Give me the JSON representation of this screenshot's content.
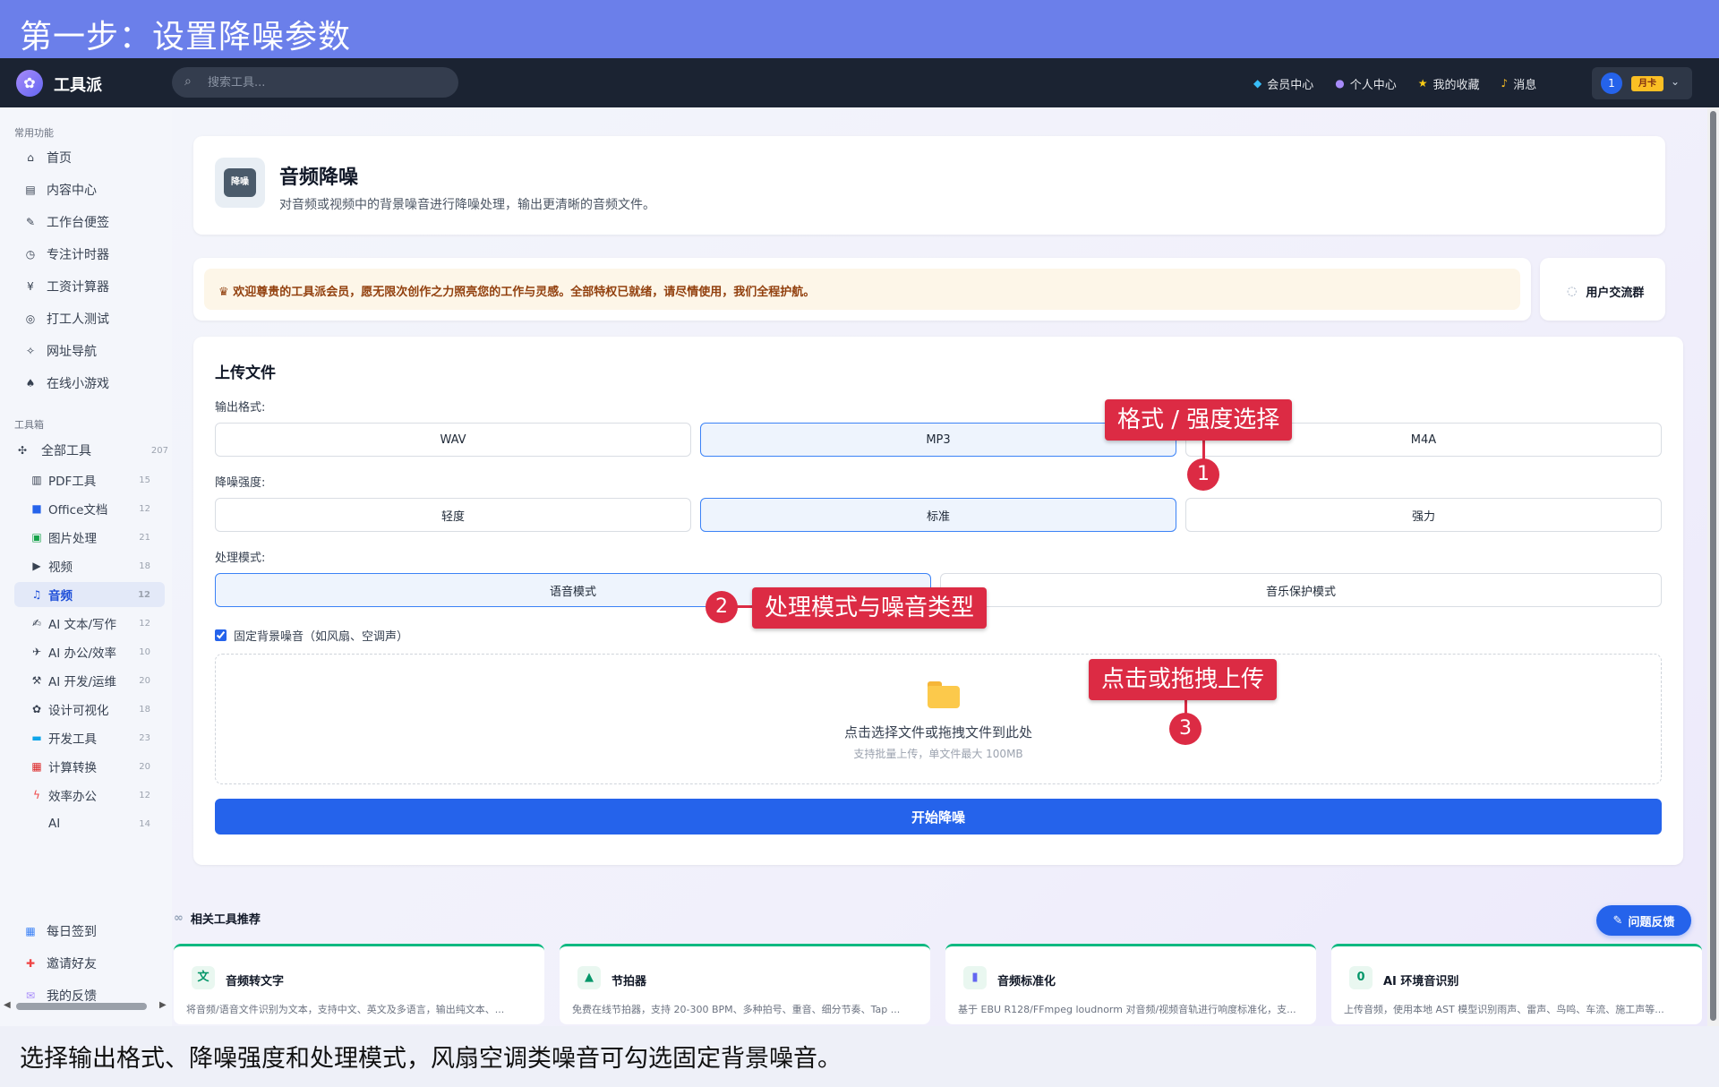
{
  "banner": {
    "title": "第一步：设置降噪参数"
  },
  "caption": {
    "text": "选择输出格式、降噪强度和处理模式，风扇空调类噪音可勾选固定背景噪音。"
  },
  "navbar": {
    "brand": "工具派",
    "search_placeholder": "搜索工具...",
    "links": [
      {
        "icon": "diamond-icon",
        "label": "会员中心"
      },
      {
        "icon": "user-icon",
        "label": "个人中心"
      },
      {
        "icon": "star-icon",
        "label": "我的收藏"
      },
      {
        "icon": "bell-icon",
        "label": "消息"
      }
    ],
    "avatar_text": "1",
    "badge": "月卡"
  },
  "sidebar": {
    "common_title": "常用功能",
    "common": [
      {
        "icon": "home-icon",
        "label": "首页"
      },
      {
        "icon": "content-icon",
        "label": "内容中心"
      },
      {
        "icon": "note-icon",
        "label": "工作台便签"
      },
      {
        "icon": "timer-icon",
        "label": "专注计时器"
      },
      {
        "icon": "salary-icon",
        "label": "工资计算器"
      },
      {
        "icon": "target-icon",
        "label": "打工人测试"
      },
      {
        "icon": "compass-icon",
        "label": "网址导航"
      },
      {
        "icon": "gamepad-icon",
        "label": "在线小游戏"
      }
    ],
    "toolbox_title": "工具箱",
    "all_tools": {
      "label": "全部工具",
      "count": "207"
    },
    "categories": [
      {
        "icon": "pdf-icon",
        "label": "PDF工具",
        "count": "15"
      },
      {
        "icon": "office-icon",
        "label": "Office文档",
        "count": "12"
      },
      {
        "icon": "image-icon",
        "label": "图片处理",
        "count": "21"
      },
      {
        "icon": "video-icon",
        "label": "视频",
        "count": "18"
      },
      {
        "icon": "music-icon",
        "label": "音频",
        "count": "12",
        "active": true
      },
      {
        "icon": "ai-write-icon",
        "label": "AI 文本/写作",
        "count": "12"
      },
      {
        "icon": "ai-office-icon",
        "label": "AI 办公/效率",
        "count": "10"
      },
      {
        "icon": "ai-dev-icon",
        "label": "AI 开发/运维",
        "count": "20"
      },
      {
        "icon": "design-icon",
        "label": "设计可视化",
        "count": "18"
      },
      {
        "icon": "dev-icon",
        "label": "开发工具",
        "count": "23"
      },
      {
        "icon": "calc-icon",
        "label": "计算转换",
        "count": "20"
      },
      {
        "icon": "bolt-icon",
        "label": "效率办公",
        "count": "12"
      },
      {
        "icon": "",
        "label": "AI",
        "count": "14"
      }
    ],
    "bottom": [
      {
        "icon": "calendar-icon",
        "label": "每日签到"
      },
      {
        "icon": "gift-icon",
        "label": "邀请好友"
      },
      {
        "icon": "chat-icon",
        "label": "我的反馈"
      }
    ]
  },
  "tool": {
    "icon_text": "降噪",
    "title": "音频降噪",
    "desc": "对音频或视频中的背景噪音进行降噪处理，输出更清晰的音频文件。"
  },
  "notice": {
    "text": "欢迎尊贵的工具派会员，愿无限次创作之力照亮您的工作与灵感。全部特权已就绪，请尽情使用，我们全程护航。",
    "group_label": "用户交流群"
  },
  "upload": {
    "title": "上传文件",
    "format_label": "输出格式:",
    "formats": [
      "WAV",
      "MP3",
      "M4A"
    ],
    "format_selected": "MP3",
    "strength_label": "降噪强度:",
    "strengths": [
      "轻度",
      "标准",
      "强力"
    ],
    "strength_selected": "标准",
    "mode_label": "处理模式:",
    "modes": [
      "语音模式",
      "音乐保护模式"
    ],
    "mode_selected": "语音模式",
    "fixed_noise_label": "固定背景噪音（如风扇、空调声）",
    "fixed_noise_checked": true,
    "drop_main": "点击选择文件或拖拽文件到此处",
    "drop_sub": "支持批量上传，单文件最大 100MB",
    "start_button": "开始降噪"
  },
  "related": {
    "title": "相关工具推荐",
    "items": [
      {
        "icon": "transcribe-icon",
        "name": "音频转文字",
        "desc": "将音频/语音文件识别为文本，支持中文、英文及多语言，输出纯文本、..."
      },
      {
        "icon": "metronome-icon",
        "name": "节拍器",
        "desc": "免费在线节拍器，支持 20-300 BPM、多种拍号、重音、细分节奏、Tap ..."
      },
      {
        "icon": "equalizer-icon",
        "name": "音频标准化",
        "desc": "基于 EBU R128/FFmpeg loudnorm 对音频/视频音轨进行响度标准化，支..."
      },
      {
        "icon": "zero-icon",
        "name": "AI 环境音识别",
        "desc": "上传音频，使用本地 AST 模型识别雨声、雷声、鸟鸣、车流、施工声等..."
      }
    ]
  },
  "feedback_button": "问题反馈",
  "annotations": [
    {
      "label": "格式 / 强度选择",
      "num": "1"
    },
    {
      "label": "处理模式与噪音类型",
      "num": "2"
    },
    {
      "label": "点击或拖拽上传",
      "num": "3"
    }
  ],
  "colors": {
    "accent": "#2563eb",
    "annotation": "#dc2b44",
    "banner": "#6b7fea",
    "navbar": "#1b2332"
  }
}
